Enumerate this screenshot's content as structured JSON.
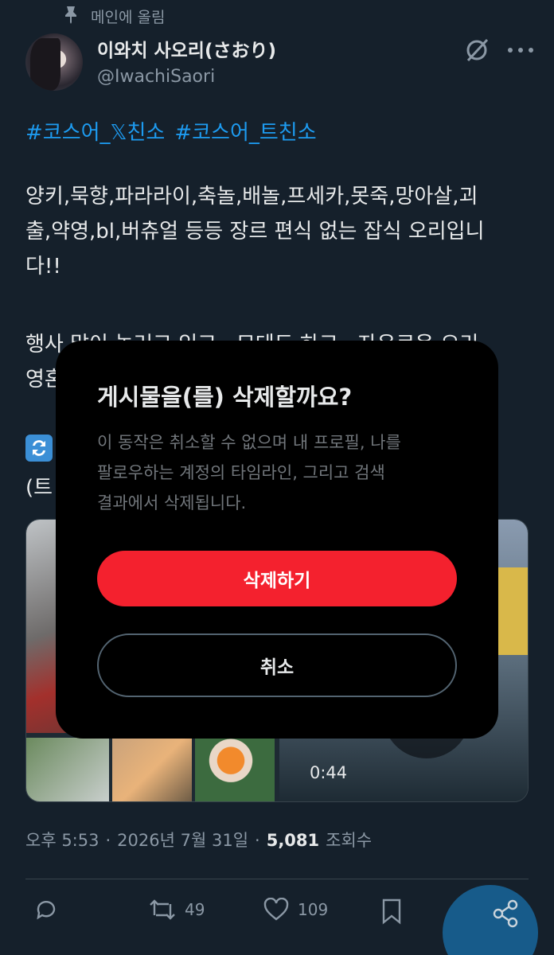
{
  "pinned": {
    "label": "메인에 올림",
    "icon": "pin-icon"
  },
  "author": {
    "name": "이와치 사오리(さおり)",
    "handle": "@IwachiSaori"
  },
  "post": {
    "hashtags": [
      "#코스어_𝕏친소",
      "#코스어_트친소"
    ],
    "lines": [
      "양키,묵향,파라라이,축놀,배놀,프세카,못죽,망아살,괴",
      "출,약영,bl,버츄얼 등등 장르 편식 없는 잡식 오리입니",
      "다!!",
      "행사 많이 놀러고 있고 , 모데도 하고 , 자유로운 오리",
      "영혼"
    ],
    "paren_text": "(트"
  },
  "media": {
    "duration": "0:44"
  },
  "meta": {
    "time": "오후 5:53",
    "separator": "·",
    "date": "2026년 7월 31일",
    "views_count": "5,081",
    "views_label": "조회수"
  },
  "actions": {
    "retweets": "49",
    "likes": "109"
  },
  "dialog": {
    "title": "게시물을(를) 삭제할까요?",
    "message_lines": [
      "이 동작은 취소할 수 없으며 내 프로필, 나를",
      "팔로우하는 계정의 타임라인, 그리고 검색",
      "결과에서 삭제됩니다."
    ],
    "delete_label": "삭제하기",
    "cancel_label": "취소"
  },
  "colors": {
    "background": "#15202b",
    "accent": "#1d9bf0",
    "danger": "#f4212e",
    "dialog": "#000000"
  }
}
